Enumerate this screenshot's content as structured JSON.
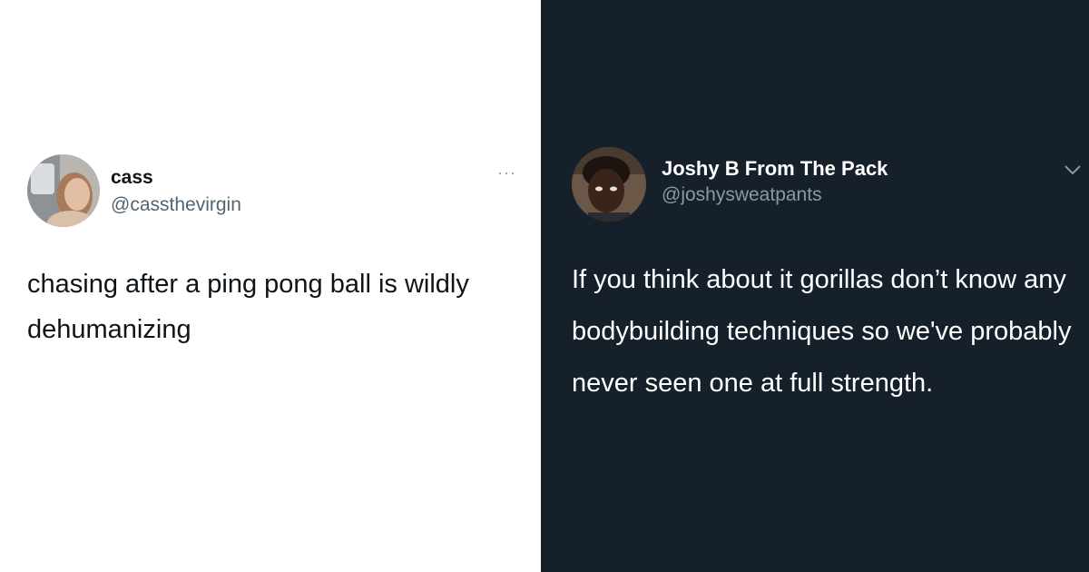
{
  "tweets": {
    "left": {
      "display_name": "cass",
      "handle": "@cassthevirgin",
      "more_glyph": "···",
      "text": "chasing after a ping pong ball is wildly dehumanizing",
      "theme_bg": "#ffffff",
      "text_color": "#0f1419",
      "handle_color": "#536471"
    },
    "right": {
      "display_name": "Joshy B From The Pack",
      "handle": "@joshysweatpants",
      "menu_icon": "chevron-down-icon",
      "text": "If you think about it gorillas don’t know any bodybuilding techniques so we've probably never seen one at full strength.",
      "theme_bg": "#15202b",
      "text_color": "#ffffff",
      "handle_color": "#8899a6"
    }
  }
}
